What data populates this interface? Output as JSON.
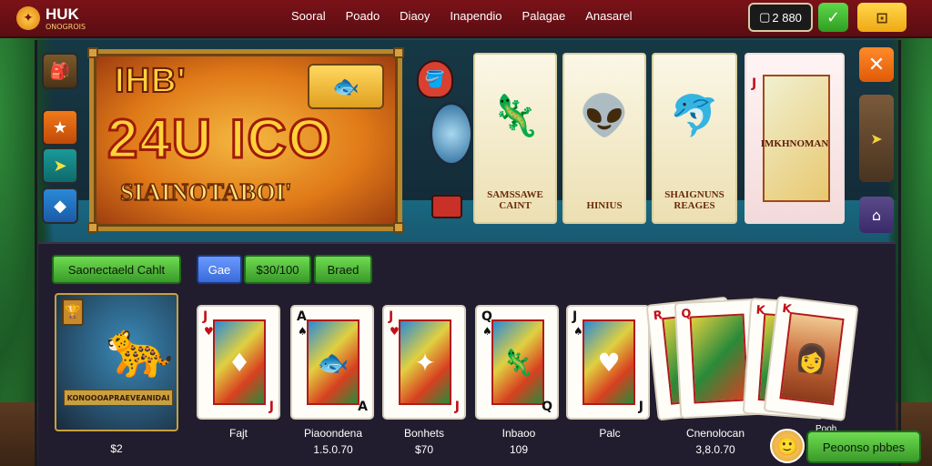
{
  "header": {
    "logo_title": "HUK",
    "logo_sub": "ONOGROIS",
    "nav": [
      "Sooral",
      "Poado",
      "Diaoy",
      "Inapendio",
      "Palagae",
      "Anasarel"
    ],
    "balance": "2 880",
    "colors": {
      "topbar": "#7a1218",
      "green": "#3a9a2a",
      "yellow": "#f0a814"
    }
  },
  "banner": {
    "line1": "IHB'",
    "line2": "24U ICO",
    "line3": "SIAINOTABOI'"
  },
  "top_cards": [
    {
      "label": "SAMSSAWE CAINT",
      "icon": "chameleon-icon"
    },
    {
      "label": "HINIUS",
      "icon": "alien-icon"
    },
    {
      "label": "SHAIGNUNS REAGES",
      "icon": "fish-icon"
    },
    {
      "label": "IMKHNOMAN",
      "icon": "dragon-icon",
      "rank": "J"
    }
  ],
  "buttons": {
    "green1": "Saonectaeld Cahlt",
    "blue": "Gae",
    "green2": "$30/100",
    "green3": "Braed"
  },
  "character_tile": {
    "plaque": "KONOOOAPRAEVEANIDAI",
    "label": "$2"
  },
  "cards": [
    {
      "rank": "J",
      "suit": "♥",
      "label": "Fajt",
      "value": ""
    },
    {
      "rank": "A",
      "suit": "♠",
      "label": "Piaoondena",
      "value": "1.5.0.70"
    },
    {
      "rank": "J",
      "suit": "♥",
      "label": "Bonhets",
      "value": "$70"
    },
    {
      "rank": "Q",
      "suit": "♠",
      "label": "Inbaoo",
      "value": "109"
    },
    {
      "rank": "J",
      "suit": "♠",
      "label": "Palc",
      "value": ""
    }
  ],
  "fan_cards": [
    {
      "rank": "R"
    },
    {
      "rank": "Q"
    },
    {
      "rank": "K"
    },
    {
      "rank": "K"
    }
  ],
  "fan_label": "Cnenolocan",
  "fan_value": "3,8.0.70",
  "promo": {
    "tag": "Pooh",
    "button": "Peoonso pbbes"
  }
}
